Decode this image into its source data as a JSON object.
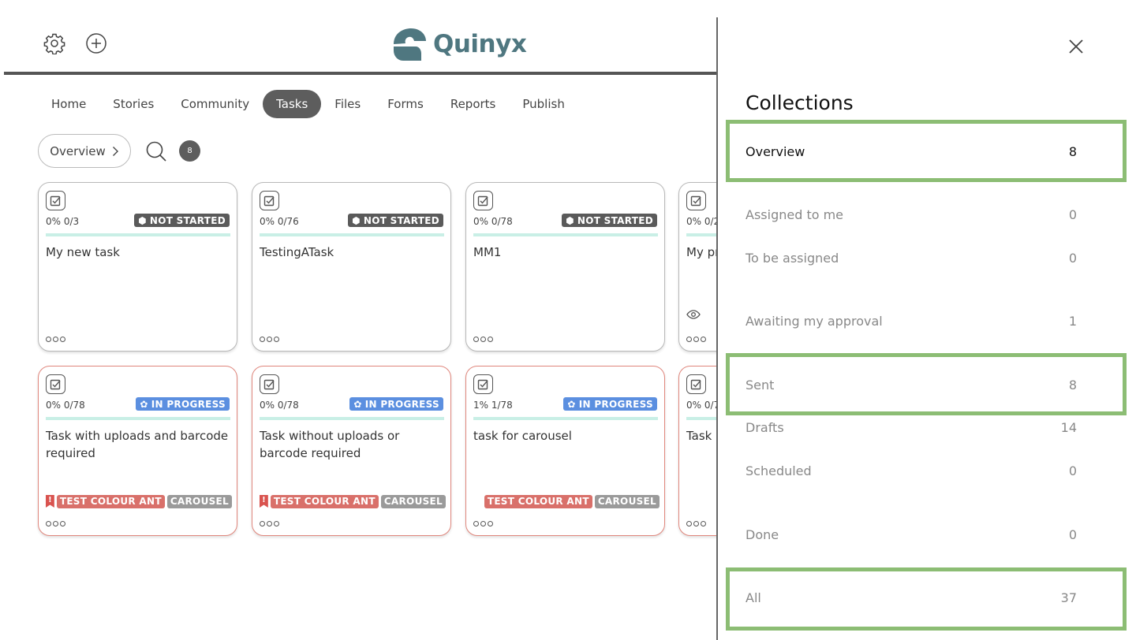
{
  "header": {
    "logo_text": "Quinyx",
    "settings_icon": "gear-icon",
    "add_icon": "plus-circle-icon",
    "brand_color": "#4f7780"
  },
  "nav": {
    "items": [
      {
        "label": "Home"
      },
      {
        "label": "Stories"
      },
      {
        "label": "Community"
      },
      {
        "label": "Tasks",
        "active": true
      },
      {
        "label": "Files"
      },
      {
        "label": "Forms"
      },
      {
        "label": "Reports"
      },
      {
        "label": "Publish"
      }
    ]
  },
  "toolbar": {
    "breadcrumb": "Overview",
    "count": "8"
  },
  "cards": [
    {
      "progress": "0% 0/3",
      "status": "NOT STARTED",
      "title": "My new task"
    },
    {
      "progress": "0% 0/76",
      "status": "NOT STARTED",
      "title": "TestingATask"
    },
    {
      "progress": "0% 0/78",
      "status": "NOT STARTED",
      "title": "MM1"
    },
    {
      "progress": "0% 0/2",
      "title": "My pr"
    },
    {
      "progress": "0% 0/78",
      "status": "IN PROGRESS",
      "title": "Task with uploads and barcode required",
      "tag1": "TEST COLOUR ANT",
      "tag2": "CAROUSEL"
    },
    {
      "progress": "0% 0/78",
      "status": "IN PROGRESS",
      "title": "Task without uploads or barcode required",
      "tag1": "TEST COLOUR ANT",
      "tag2": "CAROUSEL"
    },
    {
      "progress": "1% 1/78",
      "status": "IN PROGRESS",
      "title": "task for carousel",
      "tag1": "TEST COLOUR ANT",
      "tag2": "CAROUSEL"
    },
    {
      "progress": "0% 0/7",
      "title": "Task"
    }
  ],
  "status_colors": {
    "not_started": "#5a5a5a",
    "in_progress": "#5b8fe0",
    "tag_red": "#d9706a",
    "tag_grey": "#9a9a9a",
    "highlight": "#8cbd74"
  },
  "panel": {
    "title": "Collections",
    "items": [
      {
        "label": "Overview",
        "count": "8"
      },
      {
        "label": "Assigned to me",
        "count": "0"
      },
      {
        "label": "To be assigned",
        "count": "0"
      },
      {
        "label": "Awaiting my approval",
        "count": "1"
      },
      {
        "label": "Sent",
        "count": "8"
      },
      {
        "label": "Drafts",
        "count": "14"
      },
      {
        "label": "Scheduled",
        "count": "0"
      },
      {
        "label": "Done",
        "count": "0"
      },
      {
        "label": "All",
        "count": "37"
      }
    ]
  }
}
